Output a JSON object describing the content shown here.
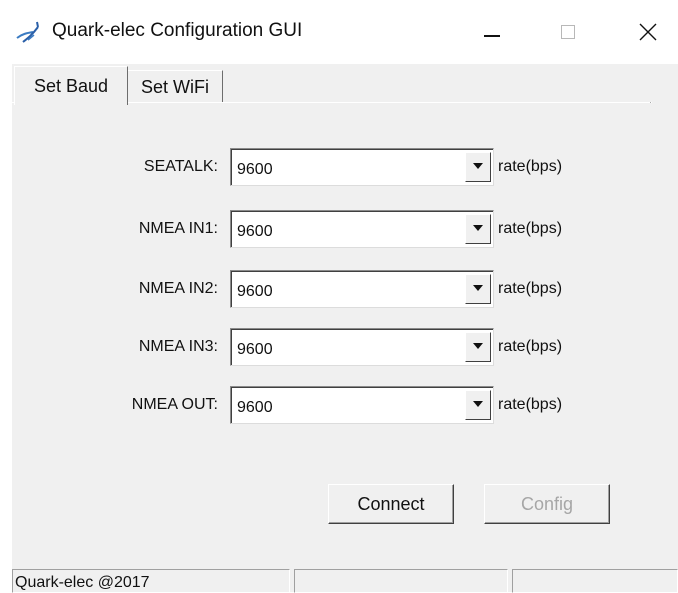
{
  "window": {
    "title": "Quark-elec Configuration GUI",
    "icon": "quark-elec-app-icon",
    "controls": [
      "minimize",
      "maximize",
      "close"
    ]
  },
  "tabs": [
    {
      "label": "Set Baud",
      "selected": true
    },
    {
      "label": "Set WiFi",
      "selected": false
    }
  ],
  "ports": [
    {
      "label": "SEATALK:",
      "value": "9600",
      "unit": "rate(bps)"
    },
    {
      "label": "NMEA IN1:",
      "value": "9600",
      "unit": "rate(bps)"
    },
    {
      "label": "NMEA IN2:",
      "value": "9600",
      "unit": "rate(bps)"
    },
    {
      "label": "NMEA IN3:",
      "value": "9600",
      "unit": "rate(bps)"
    },
    {
      "label": "NMEA OUT:",
      "value": "9600",
      "unit": "rate(bps)"
    }
  ],
  "buttons": {
    "connect": {
      "label": "Connect",
      "enabled": true
    },
    "config": {
      "label": "Config",
      "enabled": false
    }
  },
  "status": {
    "text": "Quark-elec @2017",
    "panels": [
      "",
      ""
    ]
  },
  "colors": {
    "dialog_bg": "#f0f0f0",
    "disabled_text": "#a6a6a6"
  }
}
